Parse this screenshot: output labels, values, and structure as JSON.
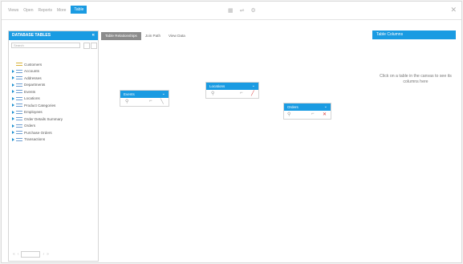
{
  "topbar": {
    "nav": [
      "Views",
      "Open",
      "Reports",
      "More"
    ],
    "active_tab": "Table",
    "controls": {
      "grid_icon": "grid-icon",
      "split_icon": "split-icon",
      "settings_icon": "settings-icon"
    }
  },
  "left_panel": {
    "title": "DATABASE TABLES",
    "filter_placeholder": "Search",
    "items": [
      {
        "label": "Customers",
        "icon": "yellow"
      },
      {
        "label": "Accounts",
        "icon": "blue"
      },
      {
        "label": "Addresses",
        "icon": "blue"
      },
      {
        "label": "Departments",
        "icon": "blue"
      },
      {
        "label": "Events",
        "icon": "blue"
      },
      {
        "label": "Locations",
        "icon": "blue"
      },
      {
        "label": "Product Categories",
        "icon": "blue"
      },
      {
        "label": "Employees",
        "icon": "blue"
      },
      {
        "label": "Order Details Summary",
        "icon": "blue"
      },
      {
        "label": "Orders",
        "icon": "blue"
      },
      {
        "label": "Purchase Orders",
        "icon": "blue"
      },
      {
        "label": "Transactions",
        "icon": "blue"
      }
    ]
  },
  "tabs": [
    "Table Relationships",
    "Join Path",
    "View Data"
  ],
  "canvas_tables": [
    {
      "title": "Events"
    },
    {
      "title": "Locations"
    },
    {
      "title": "Orders"
    }
  ],
  "right_panel": {
    "title": "Table Columns",
    "message": "Click on a table in the canvas to see its columns here"
  },
  "colors": {
    "accent": "#1a9be2",
    "active_tab": "#8c8c8c",
    "danger": "#d93b3b"
  }
}
